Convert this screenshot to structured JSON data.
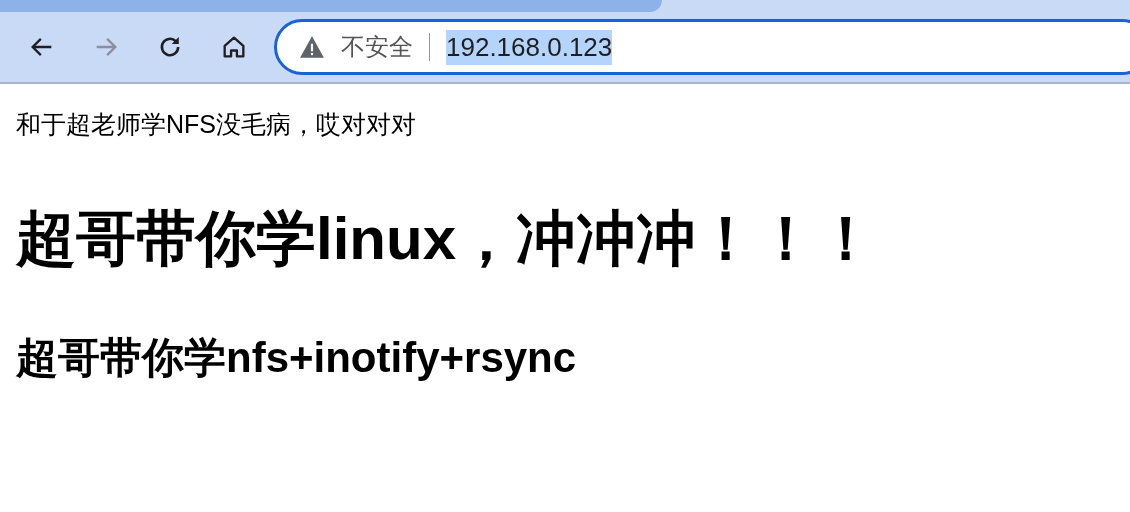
{
  "toolbar": {
    "back": {
      "disabled": false
    },
    "forward": {
      "disabled": true
    },
    "address": {
      "security": "不安全",
      "url": "192.168.0.123",
      "selected": true
    }
  },
  "page": {
    "paragraph": "和于超老师学NFS没毛病，哎对对对",
    "heading_1": "超哥带你学linux，冲冲冲！！！",
    "heading_2": "超哥带你学nfs+inotify+rsync"
  }
}
